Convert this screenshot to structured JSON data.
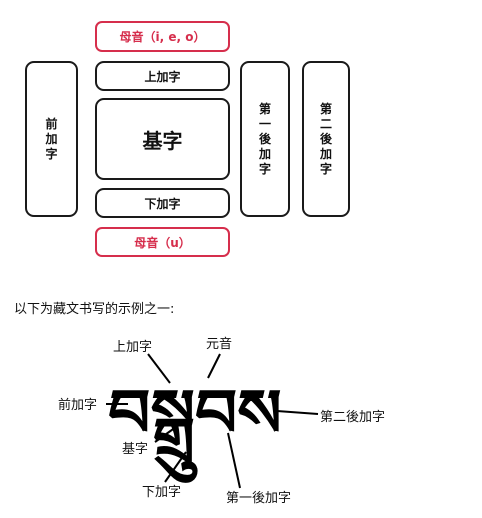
{
  "diagram": {
    "vowel_top": "母音（i, e, o）",
    "superscript": "上加字",
    "base": "基字",
    "subscript": "下加字",
    "vowel_bottom": "母音（u）",
    "prefix": "前加字",
    "suffix": "第一後加字",
    "post_suffix": "第二後加字"
  },
  "caption": "以下为藏文书写的示例之一:",
  "example": {
    "tibetan_word": "བསྒྲུབས",
    "labels": {
      "superscript": "上加字",
      "vowel": "元音",
      "prefix": "前加字",
      "post_suffix": "第二後加字",
      "base": "基字",
      "subscript": "下加字",
      "suffix": "第一後加字"
    }
  },
  "colors": {
    "accent": "#d62e4c",
    "border": "#1a1a1a"
  }
}
